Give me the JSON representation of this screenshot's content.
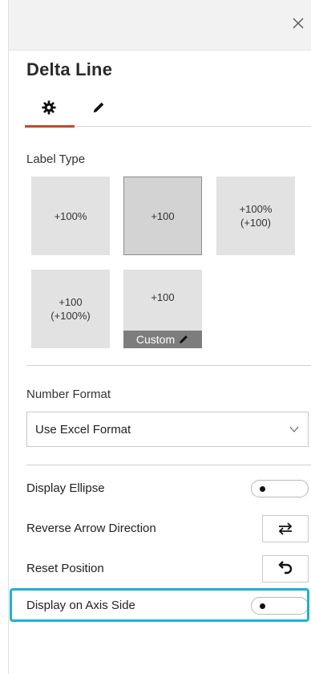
{
  "title": "Delta Line",
  "tabs": [
    {
      "icon": "gear-icon",
      "selected": true
    },
    {
      "icon": "pen-icon",
      "selected": false
    }
  ],
  "label_type": {
    "heading": "Label Type",
    "tiles": [
      {
        "line1": "+100%",
        "line2": "",
        "selected": false
      },
      {
        "line1": "+100",
        "line2": "",
        "selected": true
      },
      {
        "line1": "+100%",
        "line2": "(+100)",
        "selected": false
      },
      {
        "line1": "+100",
        "line2": "(+100%)",
        "selected": false
      },
      {
        "line1": "+100",
        "line2": "",
        "selected": false
      }
    ],
    "custom_label": "Custom"
  },
  "number_format": {
    "heading": "Number Format",
    "value": "Use Excel Format"
  },
  "options": {
    "display_ellipse": {
      "label": "Display Ellipse",
      "on": false
    },
    "reverse_arrow": {
      "label": "Reverse Arrow Direction"
    },
    "reset_position": {
      "label": "Reset Position"
    },
    "display_axis_side": {
      "label": "Display on Axis Side",
      "on": false
    }
  },
  "colors": {
    "accent": "#c4492a",
    "highlight": "#1fb1d4"
  }
}
